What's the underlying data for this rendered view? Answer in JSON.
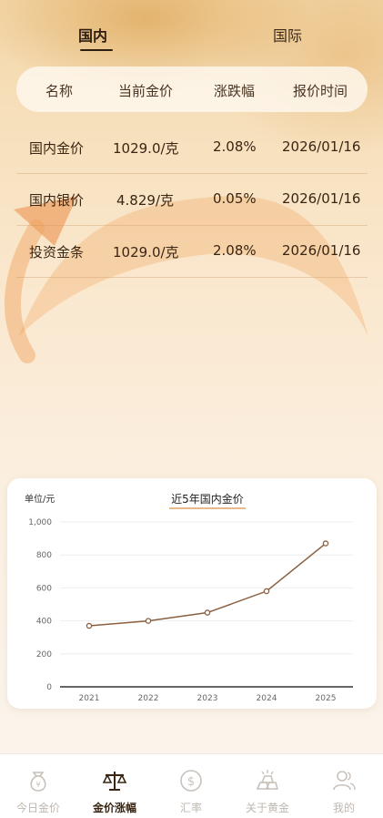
{
  "tabs": {
    "domestic": "国内",
    "international": "国际"
  },
  "table": {
    "headers": [
      "名称",
      "当前金价",
      "涨跌幅",
      "报价时间"
    ],
    "rows": [
      {
        "name": "国内金价",
        "price": "1029.0/克",
        "change": "2.08%",
        "time": "2026/01/16"
      },
      {
        "name": "国内银价",
        "price": "4.829/克",
        "change": "0.05%",
        "time": "2026/01/16"
      },
      {
        "name": "投资金条",
        "price": "1029.0/克",
        "change": "2.08%",
        "time": "2026/01/16"
      }
    ]
  },
  "chart_unit": "单位/元",
  "chart_data": {
    "type": "line",
    "title": "近5年国内金价",
    "x": [
      "2021",
      "2022",
      "2023",
      "2024",
      "2025"
    ],
    "series": [
      {
        "values": [
          370,
          400,
          450,
          580,
          870
        ]
      }
    ],
    "ylim": [
      0,
      1000
    ],
    "yticks": [
      "0",
      "200",
      "400",
      "600",
      "800",
      "1,000"
    ],
    "grid": true,
    "colors": {
      "line": "#8a6040",
      "grid": "#eeeeee",
      "axis": "#333333"
    }
  },
  "tabbar": [
    {
      "label": "今日金价",
      "icon": "money-bag-icon",
      "active": false
    },
    {
      "label": "金价涨幅",
      "icon": "balance-scale-icon",
      "active": true
    },
    {
      "label": "汇率",
      "icon": "dollar-coin-icon",
      "active": false
    },
    {
      "label": "关于黄金",
      "icon": "gold-bars-icon",
      "active": false
    },
    {
      "label": "我的",
      "icon": "user-icon",
      "active": false
    }
  ]
}
